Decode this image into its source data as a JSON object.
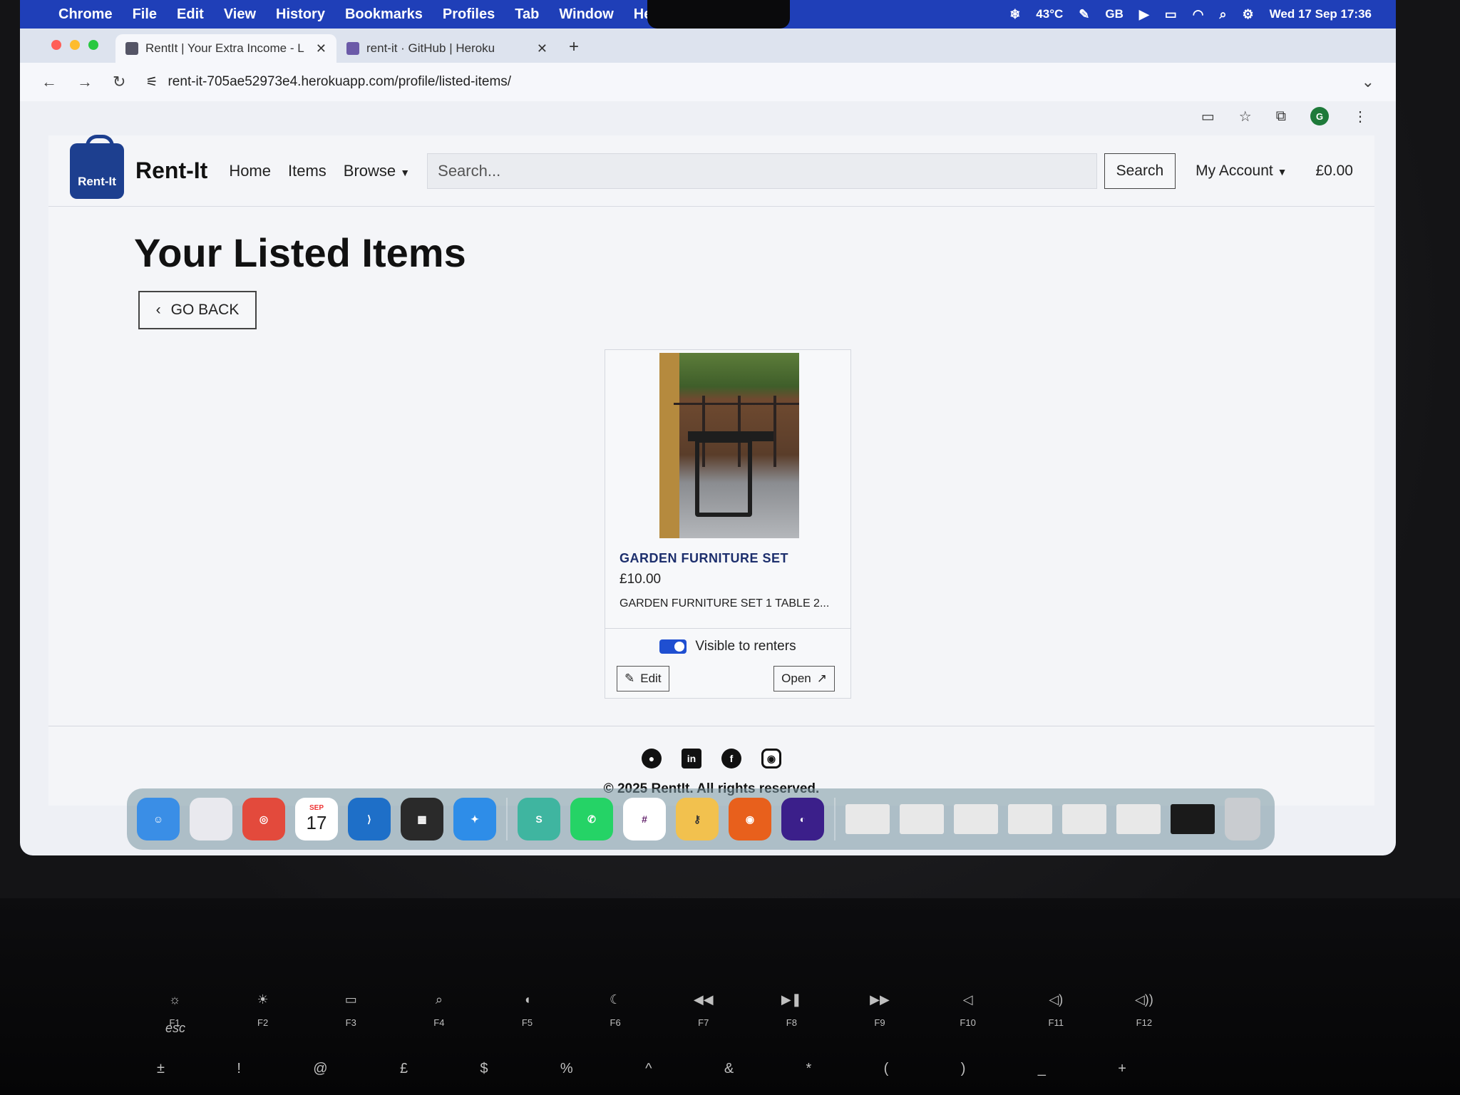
{
  "menubar": {
    "app": "Chrome",
    "items": [
      "File",
      "Edit",
      "View",
      "History",
      "Bookmarks",
      "Profiles",
      "Tab",
      "Window",
      "Help"
    ],
    "status": {
      "temperature": "43°C",
      "keyboard": "GB",
      "datetime": "Wed 17 Sep  17:36"
    }
  },
  "browser": {
    "tabs": [
      {
        "title": "RentIt | Your Extra Income - L"
      },
      {
        "title": "rent-it · GitHub | Heroku"
      }
    ],
    "url": "rent-it-705ae52973e4.herokuapp.com/profile/listed-items/",
    "profile_initial": "G"
  },
  "site": {
    "brand_logo_text": "Rent-It",
    "brand_name": "Rent-It",
    "nav": {
      "home": "Home",
      "items": "Items",
      "browse": "Browse"
    },
    "search": {
      "placeholder": "Search...",
      "button": "Search"
    },
    "account": "My Account",
    "balance": "£0.00",
    "page_title": "Your Listed Items",
    "go_back": "GO BACK",
    "items": [
      {
        "title": "GARDEN FURNITURE SET",
        "price": "£10.00",
        "description": "GARDEN FURNITURE SET 1 TABLE 2...",
        "visibility_label": "Visible to renters",
        "visible": true,
        "edit_label": "Edit",
        "open_label": "Open"
      }
    ],
    "socials": [
      "github-icon",
      "linkedin-icon",
      "facebook-icon",
      "instagram-icon"
    ],
    "copyright": "© 2025 RentIt. All rights reserved."
  },
  "dock": {
    "calendar": {
      "month": "SEP",
      "day": "17"
    }
  },
  "keyboard": {
    "esc": "esc",
    "fkeys": [
      "F1",
      "F2",
      "F3",
      "F4",
      "F5",
      "F6",
      "F7",
      "F8",
      "F9",
      "F10",
      "F11",
      "F12"
    ]
  }
}
